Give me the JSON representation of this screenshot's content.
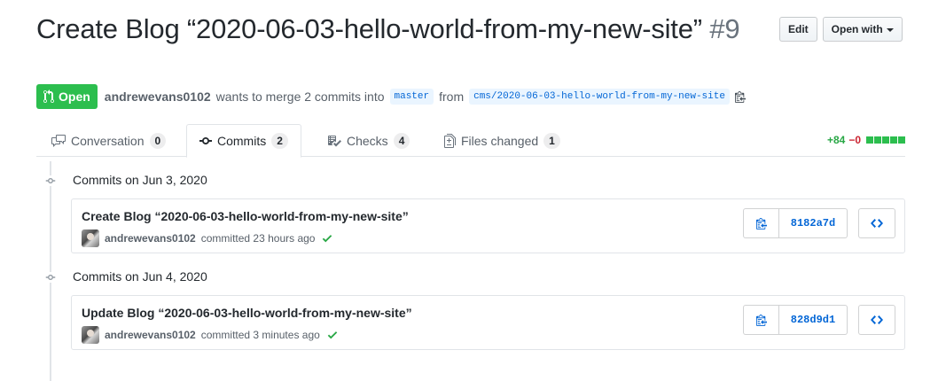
{
  "pr": {
    "title": "Create Blog “2020-06-03-hello-world-from-my-new-site”",
    "number": "#9",
    "state": "Open",
    "author": "andrewevans0102",
    "merge_text": "wants to merge 2 commits into",
    "base_branch": "master",
    "from_text": "from",
    "head_branch": "cms/2020-06-03-hello-world-from-my-new-site"
  },
  "header_actions": {
    "edit_label": "Edit",
    "open_with_label": "Open with"
  },
  "tabs": [
    {
      "label": "Conversation",
      "count": "0",
      "icon": "comment-discussion-icon"
    },
    {
      "label": "Commits",
      "count": "2",
      "icon": "git-commit-icon"
    },
    {
      "label": "Checks",
      "count": "4",
      "icon": "checklist-icon"
    },
    {
      "label": "Files changed",
      "count": "1",
      "icon": "file-diff-icon"
    }
  ],
  "diffstat": {
    "additions": "+84",
    "deletions": "−0",
    "blocks": 5
  },
  "commit_groups": [
    {
      "label": "Commits on Jun 3, 2020",
      "commit": {
        "title": "Create Blog “2020-06-03-hello-world-from-my-new-site”",
        "author": "andrewevans0102",
        "time": "committed 23 hours ago",
        "sha": "8182a7d"
      }
    },
    {
      "label": "Commits on Jun 4, 2020",
      "commit": {
        "title": "Update Blog “2020-06-03-hello-world-from-my-new-site”",
        "author": "andrewevans0102",
        "time": "committed 3 minutes ago",
        "sha": "828d9d1"
      }
    }
  ],
  "colors": {
    "open_green": "#2cbe4e",
    "link_blue": "#0366d6",
    "deletion_red": "#cb2431"
  }
}
